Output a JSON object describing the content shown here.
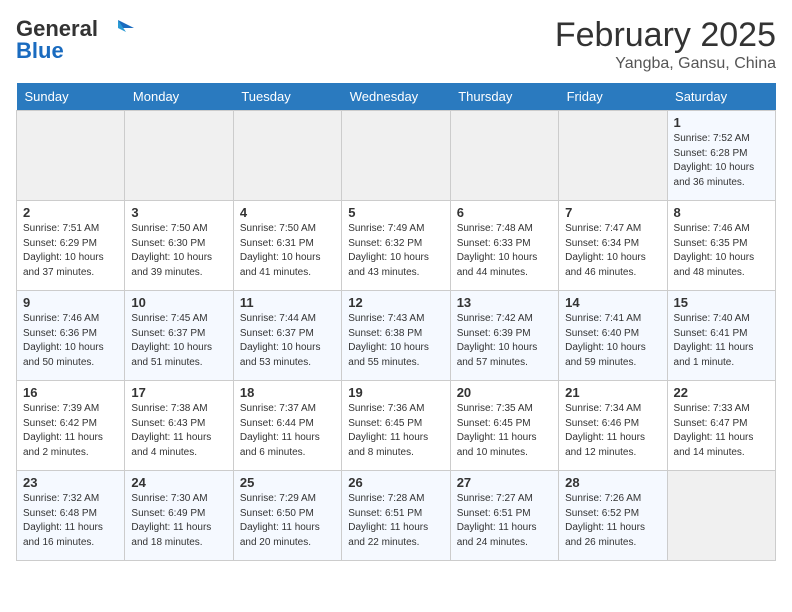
{
  "header": {
    "logo_general": "General",
    "logo_blue": "Blue",
    "month": "February 2025",
    "location": "Yangba, Gansu, China"
  },
  "days_of_week": [
    "Sunday",
    "Monday",
    "Tuesday",
    "Wednesday",
    "Thursday",
    "Friday",
    "Saturday"
  ],
  "weeks": [
    [
      {
        "day": "",
        "info": ""
      },
      {
        "day": "",
        "info": ""
      },
      {
        "day": "",
        "info": ""
      },
      {
        "day": "",
        "info": ""
      },
      {
        "day": "",
        "info": ""
      },
      {
        "day": "",
        "info": ""
      },
      {
        "day": "1",
        "info": "Sunrise: 7:52 AM\nSunset: 6:28 PM\nDaylight: 10 hours\nand 36 minutes."
      }
    ],
    [
      {
        "day": "2",
        "info": "Sunrise: 7:51 AM\nSunset: 6:29 PM\nDaylight: 10 hours\nand 37 minutes."
      },
      {
        "day": "3",
        "info": "Sunrise: 7:50 AM\nSunset: 6:30 PM\nDaylight: 10 hours\nand 39 minutes."
      },
      {
        "day": "4",
        "info": "Sunrise: 7:50 AM\nSunset: 6:31 PM\nDaylight: 10 hours\nand 41 minutes."
      },
      {
        "day": "5",
        "info": "Sunrise: 7:49 AM\nSunset: 6:32 PM\nDaylight: 10 hours\nand 43 minutes."
      },
      {
        "day": "6",
        "info": "Sunrise: 7:48 AM\nSunset: 6:33 PM\nDaylight: 10 hours\nand 44 minutes."
      },
      {
        "day": "7",
        "info": "Sunrise: 7:47 AM\nSunset: 6:34 PM\nDaylight: 10 hours\nand 46 minutes."
      },
      {
        "day": "8",
        "info": "Sunrise: 7:46 AM\nSunset: 6:35 PM\nDaylight: 10 hours\nand 48 minutes."
      }
    ],
    [
      {
        "day": "9",
        "info": "Sunrise: 7:46 AM\nSunset: 6:36 PM\nDaylight: 10 hours\nand 50 minutes."
      },
      {
        "day": "10",
        "info": "Sunrise: 7:45 AM\nSunset: 6:37 PM\nDaylight: 10 hours\nand 51 minutes."
      },
      {
        "day": "11",
        "info": "Sunrise: 7:44 AM\nSunset: 6:37 PM\nDaylight: 10 hours\nand 53 minutes."
      },
      {
        "day": "12",
        "info": "Sunrise: 7:43 AM\nSunset: 6:38 PM\nDaylight: 10 hours\nand 55 minutes."
      },
      {
        "day": "13",
        "info": "Sunrise: 7:42 AM\nSunset: 6:39 PM\nDaylight: 10 hours\nand 57 minutes."
      },
      {
        "day": "14",
        "info": "Sunrise: 7:41 AM\nSunset: 6:40 PM\nDaylight: 10 hours\nand 59 minutes."
      },
      {
        "day": "15",
        "info": "Sunrise: 7:40 AM\nSunset: 6:41 PM\nDaylight: 11 hours\nand 1 minute."
      }
    ],
    [
      {
        "day": "16",
        "info": "Sunrise: 7:39 AM\nSunset: 6:42 PM\nDaylight: 11 hours\nand 2 minutes."
      },
      {
        "day": "17",
        "info": "Sunrise: 7:38 AM\nSunset: 6:43 PM\nDaylight: 11 hours\nand 4 minutes."
      },
      {
        "day": "18",
        "info": "Sunrise: 7:37 AM\nSunset: 6:44 PM\nDaylight: 11 hours\nand 6 minutes."
      },
      {
        "day": "19",
        "info": "Sunrise: 7:36 AM\nSunset: 6:45 PM\nDaylight: 11 hours\nand 8 minutes."
      },
      {
        "day": "20",
        "info": "Sunrise: 7:35 AM\nSunset: 6:45 PM\nDaylight: 11 hours\nand 10 minutes."
      },
      {
        "day": "21",
        "info": "Sunrise: 7:34 AM\nSunset: 6:46 PM\nDaylight: 11 hours\nand 12 minutes."
      },
      {
        "day": "22",
        "info": "Sunrise: 7:33 AM\nSunset: 6:47 PM\nDaylight: 11 hours\nand 14 minutes."
      }
    ],
    [
      {
        "day": "23",
        "info": "Sunrise: 7:32 AM\nSunset: 6:48 PM\nDaylight: 11 hours\nand 16 minutes."
      },
      {
        "day": "24",
        "info": "Sunrise: 7:30 AM\nSunset: 6:49 PM\nDaylight: 11 hours\nand 18 minutes."
      },
      {
        "day": "25",
        "info": "Sunrise: 7:29 AM\nSunset: 6:50 PM\nDaylight: 11 hours\nand 20 minutes."
      },
      {
        "day": "26",
        "info": "Sunrise: 7:28 AM\nSunset: 6:51 PM\nDaylight: 11 hours\nand 22 minutes."
      },
      {
        "day": "27",
        "info": "Sunrise: 7:27 AM\nSunset: 6:51 PM\nDaylight: 11 hours\nand 24 minutes."
      },
      {
        "day": "28",
        "info": "Sunrise: 7:26 AM\nSunset: 6:52 PM\nDaylight: 11 hours\nand 26 minutes."
      },
      {
        "day": "",
        "info": ""
      }
    ]
  ]
}
